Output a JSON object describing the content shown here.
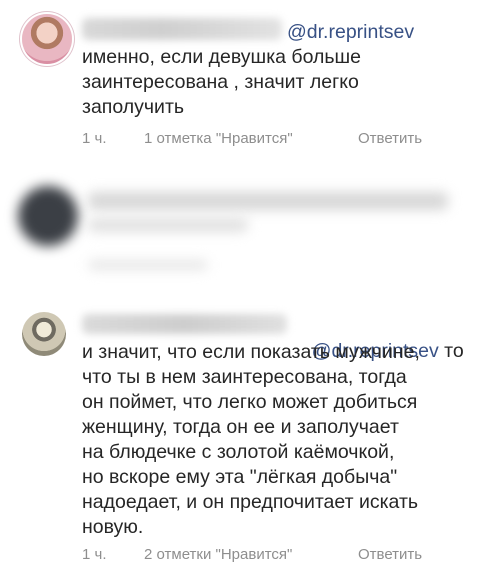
{
  "comments": [
    {
      "mention": "@dr.reprintsev",
      "body": "именно, если девушка больше\nзаинтересована , значит легко\nзаполучить",
      "time": "1 ч.",
      "likes": "1 отметка \"Нравится\"",
      "reply": "Ответить"
    },
    {
      "mention": "@dr.reprintsev",
      "after_mention": " то",
      "body": "и значит, что если показать мужчине,\nчто ты в нем заинтересована, тогда\nон поймет, что легко может добиться\nженщину, тогда он ее и заполучает\nна блюдечке с золотой каёмочкой,\nно вскоре ему эта \"лёгкая добыча\"\nнадоедает, и он предпочитает искать\nновую.",
      "time": "1 ч.",
      "likes": "2 отметки \"Нравится\"",
      "reply": "Ответить"
    }
  ]
}
